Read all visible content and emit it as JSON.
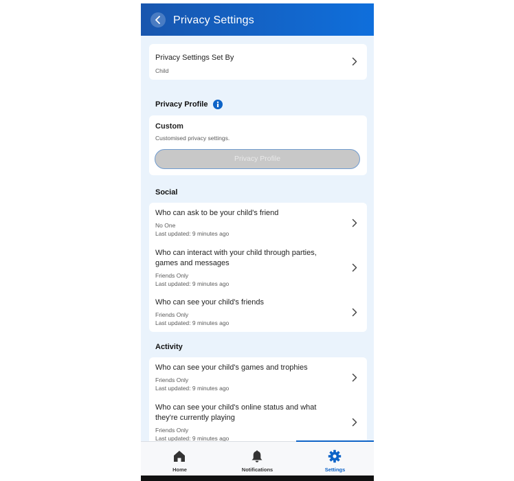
{
  "header": {
    "title": "Privacy Settings"
  },
  "set_by": {
    "title": "Privacy Settings Set By",
    "value": "Child"
  },
  "privacy_profile": {
    "section_title": "Privacy Profile",
    "name": "Custom",
    "description": "Customised privacy settings.",
    "button_label": "Privacy Profile"
  },
  "social": {
    "section_title": "Social",
    "items": [
      {
        "title": "Who can ask to be your child's friend",
        "value": "No One",
        "updated": "Last updated: 9 minutes ago"
      },
      {
        "title": "Who can interact with your child through parties, games and messages",
        "value": "Friends Only",
        "updated": "Last updated: 9 minutes ago"
      },
      {
        "title": "Who can see your child's friends",
        "value": "Friends Only",
        "updated": "Last updated: 9 minutes ago"
      }
    ]
  },
  "activity": {
    "section_title": "Activity",
    "items": [
      {
        "title": "Who can see your child's games and trophies",
        "value": "Friends Only",
        "updated": "Last updated: 9 minutes ago"
      },
      {
        "title": "Who can see your child's online status and what they're currently playing",
        "value": "Friends Only",
        "updated": "Last updated: 9 minutes ago"
      }
    ]
  },
  "nav": {
    "items": [
      {
        "label": "Home",
        "icon": "home-icon"
      },
      {
        "label": "Notifications",
        "icon": "bell-icon"
      },
      {
        "label": "Settings",
        "icon": "gear-icon",
        "active": true
      }
    ]
  },
  "colors": {
    "header_start": "#1856ae",
    "header_end": "#0f6fdc",
    "accent": "#0d63c7",
    "background": "#eaf3fc"
  }
}
